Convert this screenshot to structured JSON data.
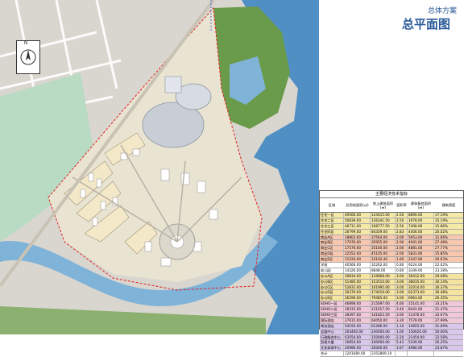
{
  "header": {
    "subtitle": "总体方案",
    "title": "总平面图"
  },
  "north_arrow": {
    "label": "N"
  },
  "colors": {
    "water": "#4f8fc4",
    "lake": "#7fb3d8",
    "green": "#6a9b4a",
    "road": "#d8d4cc",
    "boundary": "#e02020",
    "residential": "#f3e8c8"
  },
  "table": {
    "title": "主要经济技术指标",
    "headers": [
      "区域",
      "总用地面积(㎡)",
      "地上建筑面积(㎡)",
      "容积率",
      "建筑基底面积(㎡)",
      "建筑密度"
    ],
    "rows": [
      {
        "name": "住宅一区",
        "area": "49566.00",
        "floor": "124415.00",
        "far": "2.50",
        "base": "8890.00",
        "density": "17.19%",
        "color": "#f5e9a8"
      },
      {
        "name": "住宅二区",
        "area": "50839.00",
        "floor": "126341.50",
        "far": "2.50",
        "base": "1978.00",
        "density": "15.19%",
        "color": "#f5e9a8"
      },
      {
        "name": "住宅三区",
        "area": "46711.00",
        "floor": "108777.50",
        "far": "2.50",
        "base": "7408.00",
        "density": "15.86%",
        "color": "#f5e9a8"
      },
      {
        "name": "住宅四区",
        "area": "26799.00",
        "floor": "84359.00",
        "far": "2.83",
        "base": "4406.00",
        "density": "20.02%",
        "color": "#f5e9a8"
      },
      {
        "name": "商业A区",
        "area": "18802.00",
        "floor": "37564.00",
        "far": "2.00",
        "base": "5953.00",
        "density": "31.66%",
        "color": "#f7c7b0"
      },
      {
        "name": "商业B区",
        "area": "17976.00",
        "floor": "35955.00",
        "far": "2.00",
        "base": "4941.00",
        "density": "27.48%",
        "color": "#f7c7b0"
      },
      {
        "name": "商业C区",
        "area": "17576.00",
        "floor": "35160.00",
        "far": "2.00",
        "base": "4881.00",
        "density": "27.77%",
        "color": "#f7c7b0"
      },
      {
        "name": "商业D区",
        "area": "22552.00",
        "floor": "45105.00",
        "far": "2.00",
        "base": "5831.00",
        "density": "25.85%",
        "color": "#f7c7b0"
      },
      {
        "name": "商业E区",
        "area": "11520.00",
        "floor": "13102.40",
        "far": "1.60",
        "base": "2347.00",
        "density": "20.63%",
        "color": "#f7c7b0"
      },
      {
        "name": "学校",
        "area": "40566.00",
        "floor": "32262.00",
        "far": "0.80",
        "base": "9224.00",
        "density": "22.02%",
        "color": "#ffffff"
      },
      {
        "name": "幼儿园",
        "area": "14326.00",
        "floor": "8848.00",
        "far": "0.80",
        "base": "3349.00",
        "density": "23.38%",
        "color": "#ffffff"
      },
      {
        "name": "办公A区",
        "area": "39834.00",
        "floor": "119668.00",
        "far": "3.00",
        "base": "36412.00",
        "density": "29.08%",
        "color": "#f5e3a0"
      },
      {
        "name": "办公B区",
        "area": "51485.00",
        "floor": "153510.00",
        "far": "3.00",
        "base": "38035.00",
        "density": "30.14%",
        "color": "#f5e3a0"
      },
      {
        "name": "办公C区",
        "area": "52831.00",
        "floor": "101995.00",
        "far": "3.00",
        "base": "31014.00",
        "density": "30.37%",
        "color": "#f5e3a0"
      },
      {
        "name": "办公D区",
        "area": "30376.00",
        "floor": "174016.00",
        "far": "3.00",
        "base": "62373.00",
        "density": "30.48%",
        "color": "#f5e3a0"
      },
      {
        "name": "办公E区",
        "area": "26296.00",
        "floor": "79485.00",
        "far": "3.00",
        "base": "6963.00",
        "density": "26.35%",
        "color": "#f5e3a0"
      },
      {
        "name": "SOHO一区",
        "area": "46898.00",
        "floor": "215697.00",
        "far": "4.60",
        "base": "15141.00",
        "density": "33.21%",
        "color": "#f0c8d8"
      },
      {
        "name": "SOHO二区",
        "area": "39315.00",
        "floor": "131917.50",
        "far": "3.40",
        "base": "8441.00",
        "density": "21.47%",
        "color": "#f0c8d8"
      },
      {
        "name": "SOHO三区",
        "area": "38397.00",
        "floor": "141823.50",
        "far": "3.60",
        "base": "11476.00",
        "density": "32.67%",
        "color": "#f0c8d8"
      },
      {
        "name": "国际酒店",
        "area": "27615.00",
        "floor": "64050.00",
        "far": "3.30",
        "base": "7578.00",
        "density": "27.99%",
        "color": "#f0c8d8"
      },
      {
        "name": "商务酒店",
        "area": "54192.00",
        "floor": "61286.00",
        "far": "1.10",
        "base": "14925.00",
        "density": "31.09%",
        "color": "#d9c8ec"
      },
      {
        "name": "会展中心",
        "area": "203400.00",
        "floor": "230000.00",
        "far": "1.00",
        "base": "150020.00",
        "density": "50.00%",
        "color": "#d9c8ec"
      },
      {
        "name": "行政服务中心",
        "area": "63554.00",
        "floor": "150000.00",
        "far": "2.20",
        "base": "21454.00",
        "density": "32.58%",
        "color": "#d9c8ec"
      },
      {
        "name": "贸易大厦",
        "area": "16854.00",
        "floor": "100000.00",
        "far": "5.43",
        "base": "5339.00",
        "density": "26.25%",
        "color": "#d9c8ec"
      },
      {
        "name": "文化体育中心",
        "area": "20986.00",
        "floor": "35000.00",
        "far": "1.67",
        "base": "4980.00",
        "density": "23.87%",
        "color": "#d9c8ec"
      },
      {
        "name": "合计",
        "area": "1201680.00",
        "floor": "2352869.10",
        "far": "",
        "base": "",
        "density": "",
        "color": "#ffffff"
      }
    ]
  }
}
